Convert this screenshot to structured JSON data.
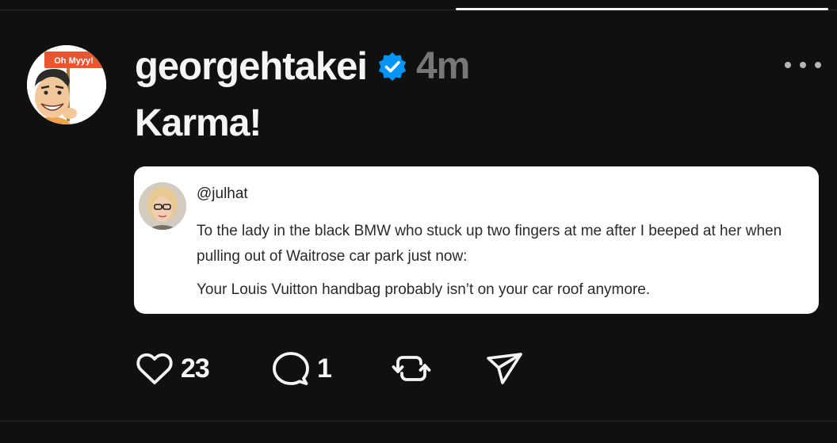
{
  "post": {
    "avatar": {
      "sign_text": "Oh Myyy!",
      "colors": {
        "sign": "#e8552f",
        "skin": "#f2c79a",
        "hair": "#2b2b2b",
        "pole": "#b08040"
      }
    },
    "username": "georgehtakei",
    "verified": true,
    "timestamp": "4m",
    "text": "Karma!",
    "quote": {
      "handle": "@julhat",
      "paragraphs": [
        "To the lady in the black BMW who stuck up two fingers at me after I beeped at her when pulling out of Waitrose car park just now:",
        "Your Louis Vuitton handbag probably isn’t on your car roof anymore."
      ]
    },
    "actions": {
      "like_count": "23",
      "reply_count": "1"
    }
  },
  "icons": {
    "like": "heart-icon",
    "reply": "speech-bubble-icon",
    "repost": "repost-arrows-icon",
    "share": "paper-plane-icon",
    "more": "ellipsis-icon",
    "verified": "verified-badge-icon"
  },
  "colors": {
    "background": "#101010",
    "primary_text": "#f3f5f7",
    "secondary_text": "#777777",
    "verified_blue": "#0095f6",
    "card": "#ffffff"
  }
}
